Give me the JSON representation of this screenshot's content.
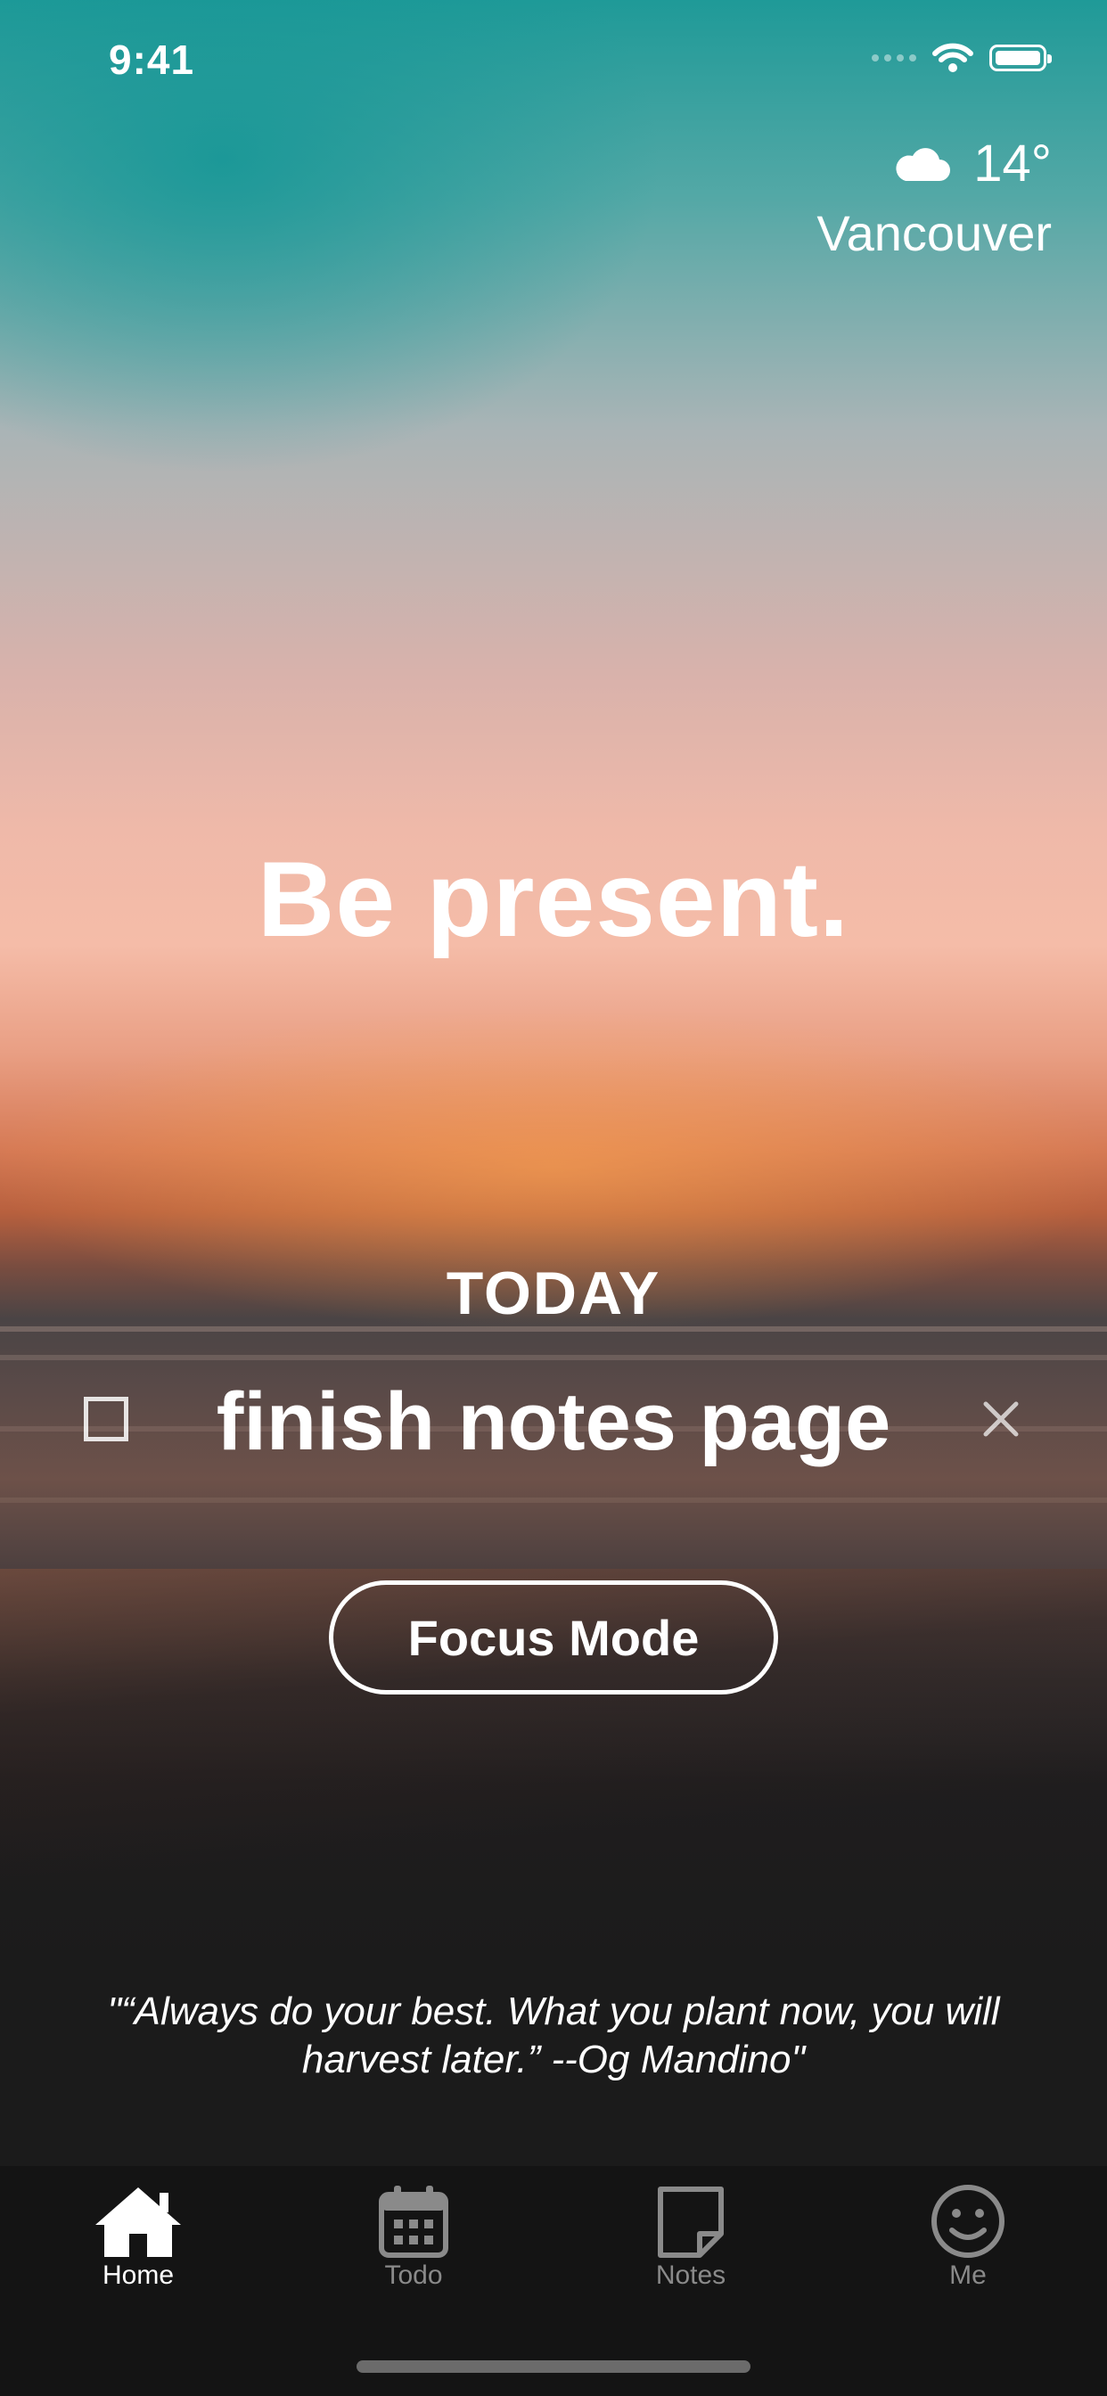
{
  "status_bar": {
    "time": "9:41"
  },
  "weather": {
    "temperature": "14°",
    "city": "Vancouver",
    "icon": "cloud-icon"
  },
  "main": {
    "headline": "Be present.",
    "today_label": "TODAY",
    "todo": {
      "text": "finish notes page",
      "checked": false
    },
    "focus_button": "Focus Mode"
  },
  "quote": "\"“Always do your best. What you plant now, you will harvest later.” --Og Mandino\"",
  "tabbar": {
    "items": [
      {
        "label": "Home",
        "icon": "home-icon",
        "active": true
      },
      {
        "label": "Todo",
        "icon": "calendar-icon",
        "active": false
      },
      {
        "label": "Notes",
        "icon": "note-icon",
        "active": false
      },
      {
        "label": "Me",
        "icon": "smiley-icon",
        "active": false
      }
    ]
  },
  "colors": {
    "tabbar_bg": "#141414",
    "inactive_tab": "#8a8a8a",
    "accent": "#ffffff"
  }
}
